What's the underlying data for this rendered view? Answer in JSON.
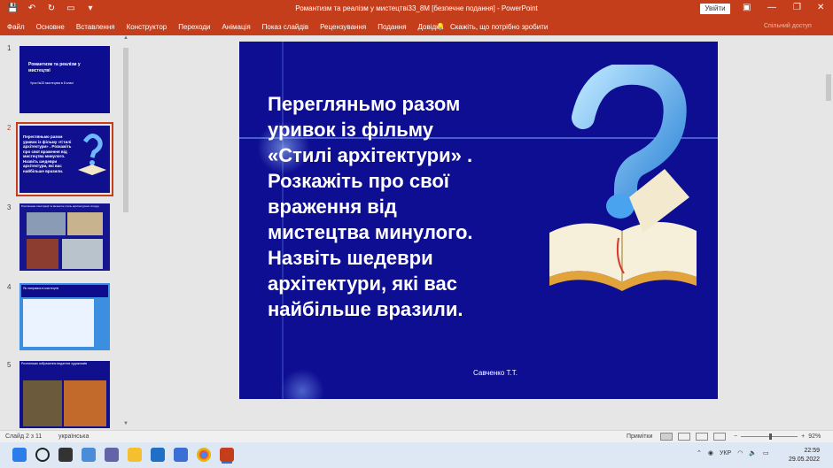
{
  "window": {
    "title": "Романтизм та реалізм у мистецтві33_8M [безпечне подання] - PowerPoint",
    "signin_label": "Увійти"
  },
  "ribbon": {
    "tabs": [
      "Файл",
      "Основне",
      "Вставлення",
      "Конструктор",
      "Переходи",
      "Анімація",
      "Показ слайдів",
      "Рецензування",
      "Подання",
      "Довідка"
    ],
    "tell_me": "Скажіть, що потрібно зробити",
    "share": "Спільний доступ"
  },
  "thumbnails": [
    {
      "number": "1",
      "title": "Романтизм та реалізм у мистецтві",
      "subtitle": "Урок №33 мистецтва в 8 класі"
    },
    {
      "number": "2",
      "text": "Перегляньмо разом уривок із фільму «Стилі архітектури» . Розкажіть про свої враження від мистецтва минулого. Назвіть шедеври архітектури, які вас найбільше вразили."
    },
    {
      "number": "3",
      "text": "Розглянемо ілюстрації та визначте стиль архітектурних споруд"
    },
    {
      "number": "4",
      "text": "Як напрямок в мистецтві"
    },
    {
      "number": "5",
      "text": "Розгляньмо зображення видатних художників"
    }
  ],
  "slide": {
    "main_text": "Перегляньмо разом\nуривок із фільму\n«Стилі архітектури» .\nРозкажіть про свої\nвраження від\nмистецтва минулого.\nНазвіть шедеври\nархітектури, які вас\nнайбільше вразили.",
    "author": "Савченко Т.Т."
  },
  "status_bar": {
    "slide_info": "Слайд 2 з 11",
    "language": "українська",
    "notes_label": "Примітки",
    "zoom": "92%"
  },
  "taskbar": {
    "language": "УКР",
    "time": "22:59",
    "date": "29.05.2022"
  },
  "colors": {
    "accent": "#c43e1c",
    "slide_bg": "#0e0e93"
  }
}
